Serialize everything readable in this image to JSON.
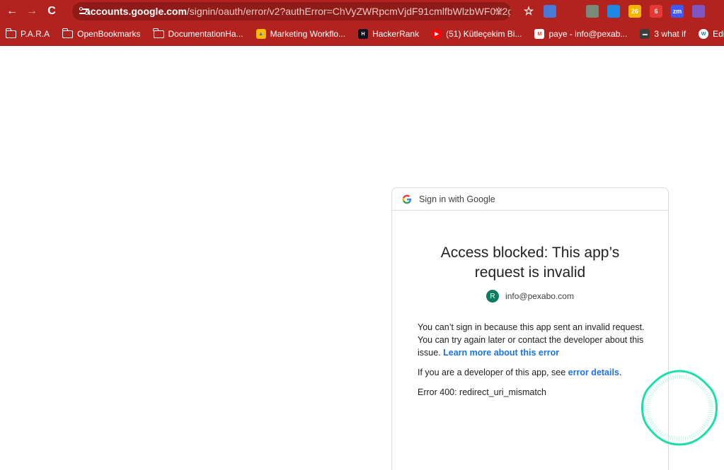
{
  "browser": {
    "url_host": "accounts.google.com",
    "url_path": "/signin/oauth/error/v2?authError=ChVyZWRpcmVjdF91cmlfbWlzbWF0Y2g...",
    "extensions": [
      {
        "name": "calendar-extension",
        "color": "#4a7ad8",
        "label": ""
      },
      {
        "name": "window-extension",
        "color": "#b2231f",
        "label": ""
      },
      {
        "name": "photo-extension",
        "color": "#7a8a7a",
        "label": ""
      },
      {
        "name": "blue-circle-extension",
        "color": "#1e88e5",
        "label": ""
      },
      {
        "name": "calendar-26-extension",
        "color": "#f4b400",
        "label": "26"
      },
      {
        "name": "tag-extension",
        "color": "#e53935",
        "label": "6"
      },
      {
        "name": "zoom-extension",
        "color": "#3d5afe",
        "label": "zm"
      },
      {
        "name": "gear-extension",
        "color": "#7e57c2",
        "label": ""
      }
    ]
  },
  "bookmarks": [
    {
      "label": "P.A.R.A",
      "icon": "folder-icon"
    },
    {
      "label": "OpenBookmarks",
      "icon": "folder-icon"
    },
    {
      "label": "DocumentationHa...",
      "icon": "folder-icon"
    },
    {
      "label": "Marketing Workflo...",
      "icon": "drive-icon"
    },
    {
      "label": "HackerRank",
      "icon": "hackerrank-icon"
    },
    {
      "label": "(51) Kütleçekim Bi...",
      "icon": "youtube-icon"
    },
    {
      "label": "paye - info@pexab...",
      "icon": "gmail-icon"
    },
    {
      "label": "3 what if",
      "icon": "film-icon"
    },
    {
      "label": "Edit Post ‹ Rifat",
      "icon": "wordpress-icon"
    }
  ],
  "card": {
    "header": "Sign in with Google",
    "headline": "Access blocked: This app’s request is invalid",
    "avatar_letter": "R",
    "email": "info@pexabo.com",
    "para1": "You can’t sign in because this app sent an invalid request. You can try again later or contact the developer about this issue.",
    "para1_link": "Learn more about this error",
    "para2": "If you are a developer of this app, see",
    "para2_link": "error details",
    "para2_end": ".",
    "error_code": "Error 400: redirect_uri_mismatch"
  },
  "colors": {
    "chrome": "#b2231f",
    "link": "#1a73e8",
    "avatar": "#0a7d5f",
    "ring": "#19e0a8"
  }
}
